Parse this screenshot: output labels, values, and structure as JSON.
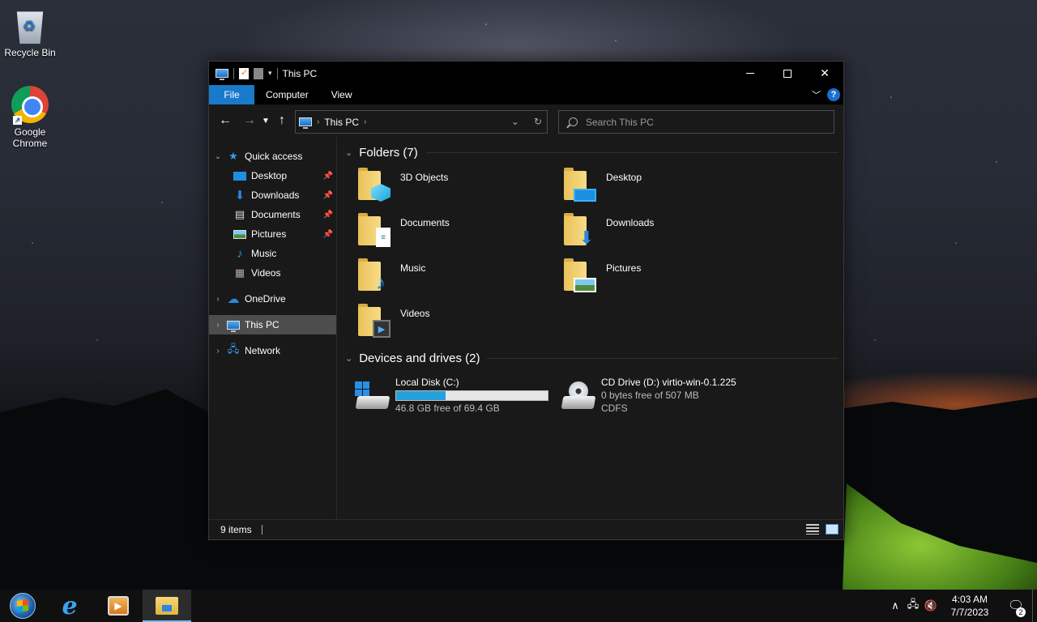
{
  "desktop": {
    "icons": [
      {
        "label": "Recycle Bin",
        "icon": "recycle-bin-icon"
      },
      {
        "label": "Google Chrome",
        "icon": "chrome-icon"
      }
    ]
  },
  "window": {
    "title": "This PC",
    "ribbon_tabs": [
      "File",
      "Computer",
      "View"
    ],
    "help_label": "?",
    "address": {
      "crumb": "This PC"
    },
    "search": {
      "placeholder": "Search This PC"
    }
  },
  "sidebar": {
    "quick_access": "Quick access",
    "quick_items": [
      "Desktop",
      "Downloads",
      "Documents",
      "Pictures",
      "Music",
      "Videos"
    ],
    "onedrive": "OneDrive",
    "this_pc": "This PC",
    "network": "Network"
  },
  "folders": {
    "header": "Folders (7)",
    "items": [
      "3D Objects",
      "Desktop",
      "Documents",
      "Downloads",
      "Music",
      "Pictures",
      "Videos"
    ]
  },
  "drives": {
    "header": "Devices and drives (2)",
    "items": [
      {
        "name": "Local Disk (C:)",
        "free": "46.8 GB free of 69.4 GB",
        "used_fraction": 0.326
      },
      {
        "name": "CD Drive (D:) virtio-win-0.1.225",
        "free": "0 bytes free of 507 MB",
        "fs": "CDFS"
      }
    ]
  },
  "status": {
    "items": "9 items"
  },
  "taskbar": {
    "time": "4:03 AM",
    "date": "7/7/2023",
    "notifications": "2"
  },
  "colors": {
    "accent": "#1979ca",
    "progress": "#26a0da",
    "background": "#191919"
  }
}
